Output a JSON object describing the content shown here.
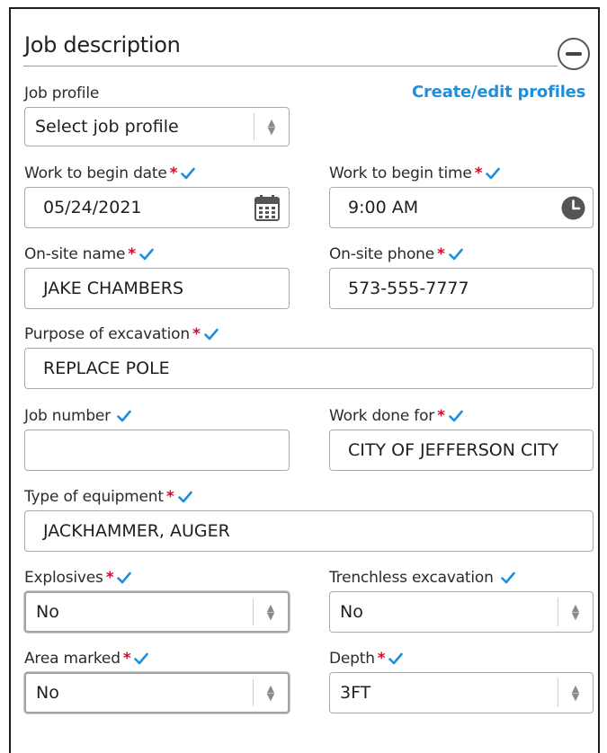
{
  "section": {
    "title": "Job description",
    "collapse_icon": "minus-circle-icon",
    "create_profiles_link": "Create/edit profiles"
  },
  "colors": {
    "accent": "#1e8fdc",
    "required": "#c8102e",
    "check": "#1e8fdc"
  },
  "fields": {
    "job_profile": {
      "label": "Job profile",
      "value": "Select job profile"
    },
    "begin_date": {
      "label": "Work to begin date",
      "value": "05/24/2021",
      "icon": "calendar-icon"
    },
    "begin_time": {
      "label": "Work to begin time",
      "value": "9:00 AM",
      "icon": "clock-icon"
    },
    "onsite_name": {
      "label": "On-site name",
      "value": "JAKE CHAMBERS"
    },
    "onsite_phone": {
      "label": "On-site phone",
      "value": "573-555-7777"
    },
    "purpose": {
      "label": "Purpose of excavation",
      "value": "REPLACE POLE"
    },
    "job_number": {
      "label": "Job number",
      "value": ""
    },
    "work_done_for": {
      "label": "Work done for",
      "value": "CITY OF JEFFERSON CITY"
    },
    "equipment": {
      "label": "Type of equipment",
      "value": "JACKHAMMER, AUGER"
    },
    "explosives": {
      "label": "Explosives",
      "value": "No"
    },
    "trenchless": {
      "label": "Trenchless excavation",
      "value": "No"
    },
    "area_marked": {
      "label": "Area marked",
      "value": "No"
    },
    "depth": {
      "label": "Depth",
      "value": "3FT"
    }
  },
  "required_marker": "*"
}
